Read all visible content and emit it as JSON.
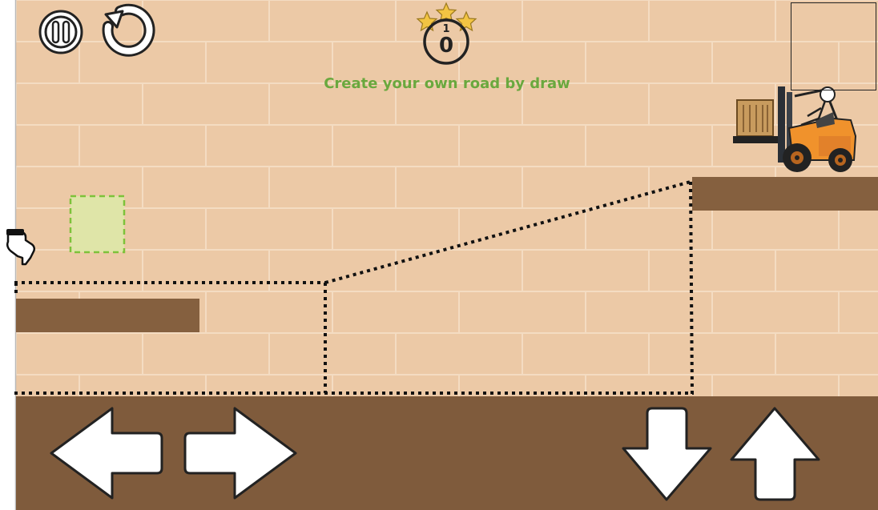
{
  "hud": {
    "pause_icon": "pause-icon",
    "restart_icon": "restart-icon",
    "level_label": "1",
    "score_value": "0",
    "stars_count": 3,
    "hint": "Create your own road by draw"
  },
  "controls": {
    "left": "arrow-left-icon",
    "right": "arrow-right-icon",
    "down": "arrow-down-icon",
    "up": "arrow-up-icon"
  },
  "colors": {
    "wall": "#ecc9a6",
    "wall_line": "#f4dcc2",
    "ground": "#7f5b3c",
    "platform": "#85603f",
    "hint": "#6aa83e",
    "target_fill": "#dfe5a8",
    "target_border": "#7dc23a",
    "forklift_body": "#f0922c",
    "crate": "#c89b5e"
  }
}
